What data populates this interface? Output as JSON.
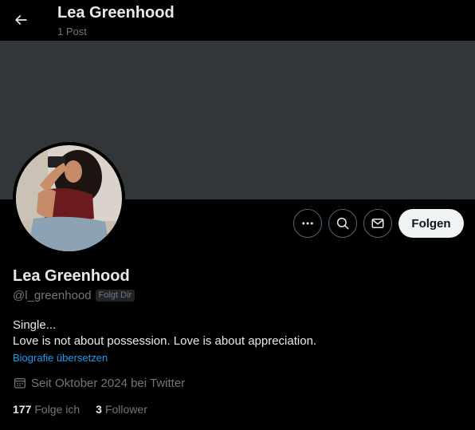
{
  "header": {
    "title": "Lea Greenhood",
    "subtitle": "1 Post"
  },
  "profile": {
    "name": "Lea Greenhood",
    "handle": "@l_greenhood",
    "follows_you_badge": "Folgt Dir",
    "bio_lines": [
      "Single...",
      "Love is not about possession. Love is about appreciation."
    ],
    "translate_link": "Biografie übersetzen",
    "joined": "Seit Oktober 2024 bei Twitter",
    "stats": {
      "following_count": "177",
      "following_label": "Folge ich",
      "followers_count": "3",
      "followers_label": "Follower"
    }
  },
  "actions": {
    "follow_label": "Folgen"
  },
  "icons": {
    "back": "back-arrow-icon",
    "more": "more-icon",
    "search": "search-icon",
    "message": "mail-icon",
    "calendar": "calendar-icon"
  },
  "colors": {
    "background": "#000000",
    "banner": "#333639",
    "link": "#1d9bf0",
    "muted": "#71767b",
    "text": "#e7e9ea",
    "follow_button_bg": "#eff3f4"
  }
}
